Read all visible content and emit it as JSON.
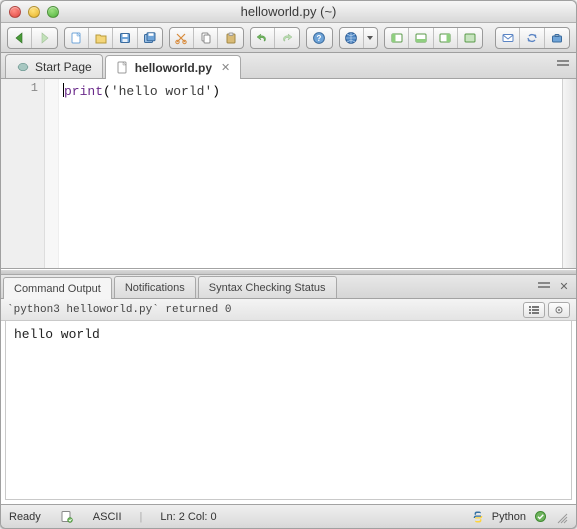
{
  "window": {
    "title": "helloworld.py (~)"
  },
  "toolbar": {
    "groups": [
      [
        "nav-back",
        "nav-forward"
      ],
      [
        "new-file",
        "open-file",
        "save-file",
        "save-all"
      ],
      [
        "cut",
        "copy",
        "paste"
      ],
      [
        "undo",
        "redo"
      ],
      [
        "help"
      ],
      [
        "globe",
        "globe-menu"
      ],
      [
        "toggle-panel-left",
        "toggle-panel-bottom",
        "toggle-panel-right",
        "preview"
      ],
      [
        "mail",
        "sync",
        "toolbox"
      ]
    ]
  },
  "editor_tabs": [
    {
      "label": "Start Page",
      "active": false,
      "closable": false,
      "icon": "komodo-icon"
    },
    {
      "label": "helloworld.py",
      "active": true,
      "closable": true,
      "icon": "file-icon"
    }
  ],
  "editor": {
    "line_numbers": [
      "1"
    ],
    "code_tokens": {
      "func": "print",
      "open": "(",
      "str": "'hello world'",
      "close": ")"
    }
  },
  "bottom_tabs": [
    {
      "label": "Command Output",
      "active": true
    },
    {
      "label": "Notifications",
      "active": false
    },
    {
      "label": "Syntax Checking Status",
      "active": false
    }
  ],
  "command_output": {
    "header": "`python3 helloworld.py` returned 0",
    "body": "hello world"
  },
  "statusbar": {
    "left": "Ready",
    "encoding": "ASCII",
    "cursor": "Ln: 2 Col: 0",
    "language": "Python"
  }
}
